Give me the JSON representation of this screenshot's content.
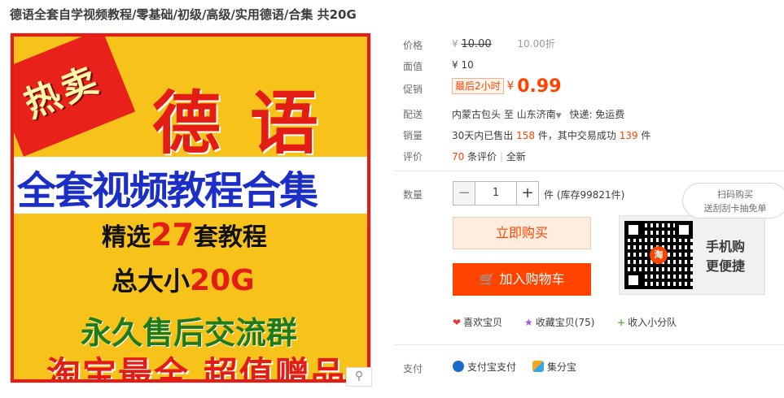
{
  "title": "德语全套自学视频教程/零基础/初级/高级/实用德语/合集 共20G",
  "poster": {
    "hot": "热卖",
    "big": "德语",
    "band": "全套视频教程合集",
    "line1_pre": "精选",
    "line1_num": "27",
    "line1_post": "套教程",
    "line2_pre": "总大小",
    "line2_num": "20G",
    "line3": "永久售后交流群",
    "line4": "淘宝最全 超值赠品"
  },
  "labels": {
    "price": "价格",
    "face": "面值",
    "promo": "促销",
    "ship": "配送",
    "sales": "销量",
    "reviews": "评价",
    "qty": "数量",
    "pay": "支付"
  },
  "price": {
    "currency": "¥",
    "original": "10.00",
    "discount": "10.00折"
  },
  "face_value": "¥ 10",
  "promo": {
    "tag": "最后2小时",
    "currency": "¥",
    "price": "0.99"
  },
  "shipping": {
    "from": "内蒙古包头",
    "to_word": "至",
    "dest": "山东济南",
    "method": "快递: 免运费"
  },
  "sales": {
    "p1": "30天内已售出",
    "sold": "158",
    "p2": "件，其中交易成功",
    "success": "139",
    "p3": "件"
  },
  "reviews": {
    "count": "70",
    "text": "条评价",
    "all": "全新"
  },
  "quantity": {
    "minus": "−",
    "value": "1",
    "plus": "+",
    "stock": "件 (库存99821件)"
  },
  "buttons": {
    "buy": "立即购买",
    "cart": "加入购物车"
  },
  "qr": {
    "bubble1": "扫码购买",
    "bubble2": "送刮刮卡抽免单",
    "text1": "手机购",
    "text2": "更便捷",
    "logo": "淘"
  },
  "actions": {
    "like": "喜欢宝贝",
    "fav": "收藏宝贝",
    "fav_count": "(75)",
    "share": "收入小分队"
  },
  "payment": {
    "alipay": "支付宝支付",
    "jifen": "集分宝"
  },
  "colors": {
    "accent": "#ff4400",
    "poster_bg": "#f7c31a",
    "poster_red": "#e41d14",
    "poster_blue": "#1b2ec8"
  },
  "icons": [
    "heart-icon",
    "star-icon",
    "plus-icon",
    "cart-icon",
    "alipay-icon",
    "jifenbao-icon",
    "zoom-icon"
  ]
}
